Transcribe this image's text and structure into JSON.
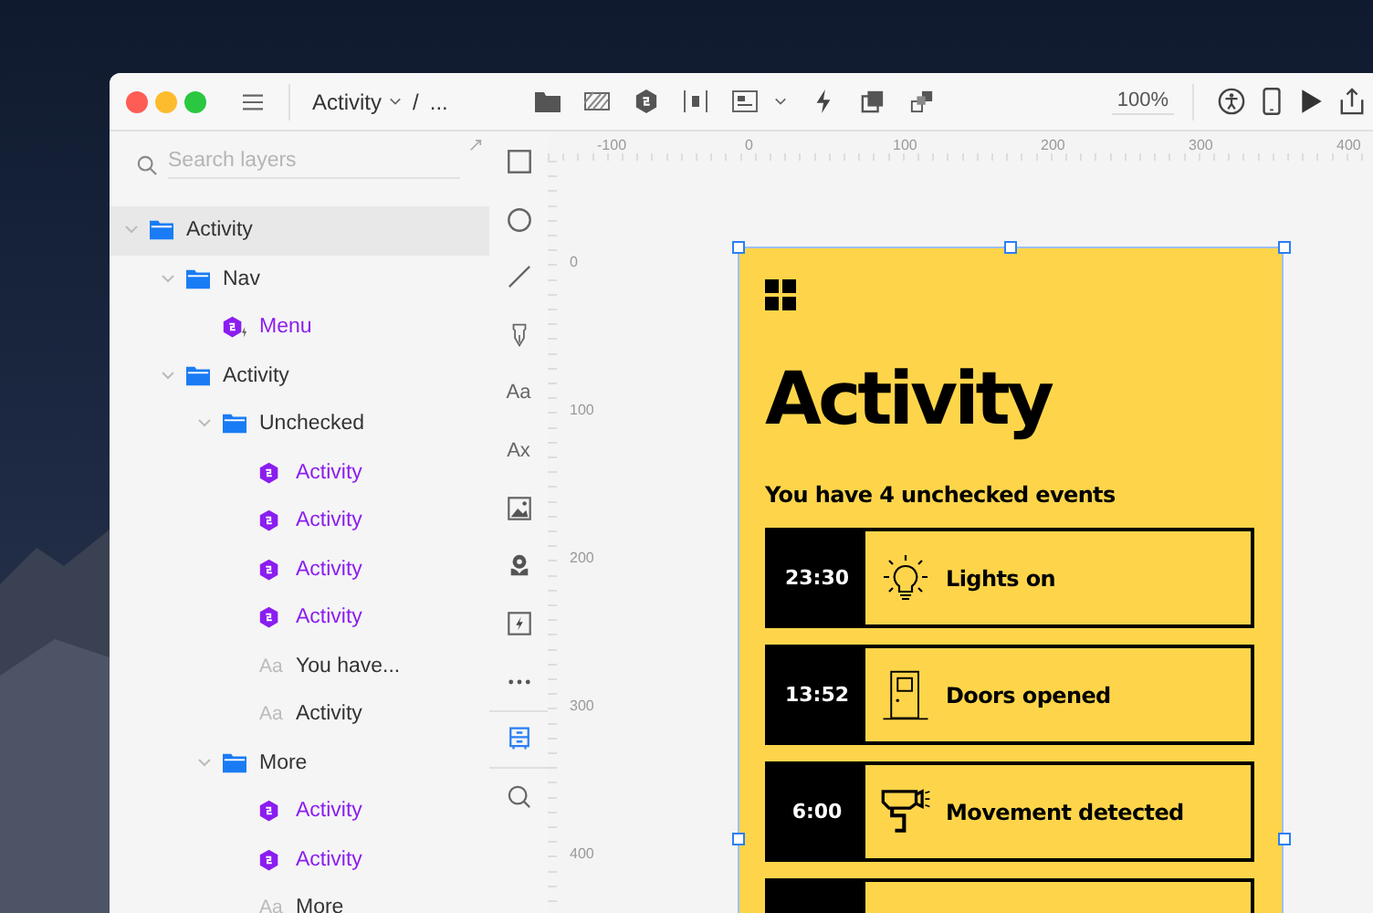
{
  "window": {
    "breadcrumb": [
      {
        "label": "Activity"
      },
      {
        "label": "/"
      },
      {
        "label": "..."
      }
    ],
    "zoom": "100%"
  },
  "sidebar": {
    "search": {
      "placeholder": "Search layers"
    },
    "layers": [
      {
        "label": "Activity",
        "kind": "folder",
        "expanded": true,
        "selected": true,
        "children": [
          {
            "label": "Nav",
            "kind": "folder",
            "expanded": true,
            "selected": false,
            "children": [
              {
                "label": "Menu",
                "kind": "linked_component",
                "selected": false
              }
            ]
          },
          {
            "label": "Activity",
            "kind": "folder",
            "expanded": true,
            "selected": false,
            "children": [
              {
                "label": "Unchecked",
                "kind": "folder",
                "expanded": true,
                "selected": false,
                "children": [
                  {
                    "label": "Activity",
                    "kind": "component",
                    "selected": false
                  },
                  {
                    "label": "Activity",
                    "kind": "component",
                    "selected": false
                  },
                  {
                    "label": "Activity",
                    "kind": "component",
                    "selected": false
                  },
                  {
                    "label": "Activity",
                    "kind": "component",
                    "selected": false
                  },
                  {
                    "label": "You have...",
                    "kind": "text",
                    "icon_label": "Aa",
                    "selected": false
                  },
                  {
                    "label": "Activity",
                    "kind": "text",
                    "icon_label": "Aa",
                    "selected": false
                  }
                ]
              },
              {
                "label": "More",
                "kind": "folder",
                "expanded": true,
                "selected": false,
                "children": [
                  {
                    "label": "Activity",
                    "kind": "component",
                    "selected": false
                  },
                  {
                    "label": "Activity",
                    "kind": "component",
                    "selected": false
                  },
                  {
                    "label": "More",
                    "kind": "text",
                    "icon_label": "Aa",
                    "selected": false
                  }
                ]
              }
            ]
          }
        ]
      }
    ]
  },
  "tools": [
    {
      "kind": "rectangle",
      "selected": false
    },
    {
      "kind": "oval",
      "selected": false
    },
    {
      "kind": "line",
      "selected": false
    },
    {
      "kind": "pen",
      "selected": false
    },
    {
      "kind": "label",
      "label": "Aa",
      "selected": false
    },
    {
      "kind": "label",
      "label": "Ax",
      "selected": false
    },
    {
      "kind": "image",
      "selected": false
    },
    {
      "kind": "icon",
      "selected": false
    },
    {
      "kind": "bolt",
      "selected": false
    },
    {
      "kind": "more",
      "selected": false
    },
    {
      "kind": "component",
      "selected": true
    },
    {
      "kind": "search",
      "selected": false
    }
  ],
  "rulers": {
    "horizontal": [
      "-100",
      "0",
      "100",
      "200",
      "300",
      "400"
    ],
    "vertical": [
      "0",
      "100",
      "200",
      "300",
      "400"
    ]
  },
  "artboard": {
    "title": "Activity",
    "subtitle": "You have 4 unchecked events",
    "events": [
      {
        "time": "23:30",
        "label": "Lights on",
        "kind": "bulb"
      },
      {
        "time": "13:52",
        "label": "Doors opened",
        "kind": "door"
      },
      {
        "time": "6:00",
        "label": "Movement detected",
        "kind": "camera"
      }
    ]
  }
}
